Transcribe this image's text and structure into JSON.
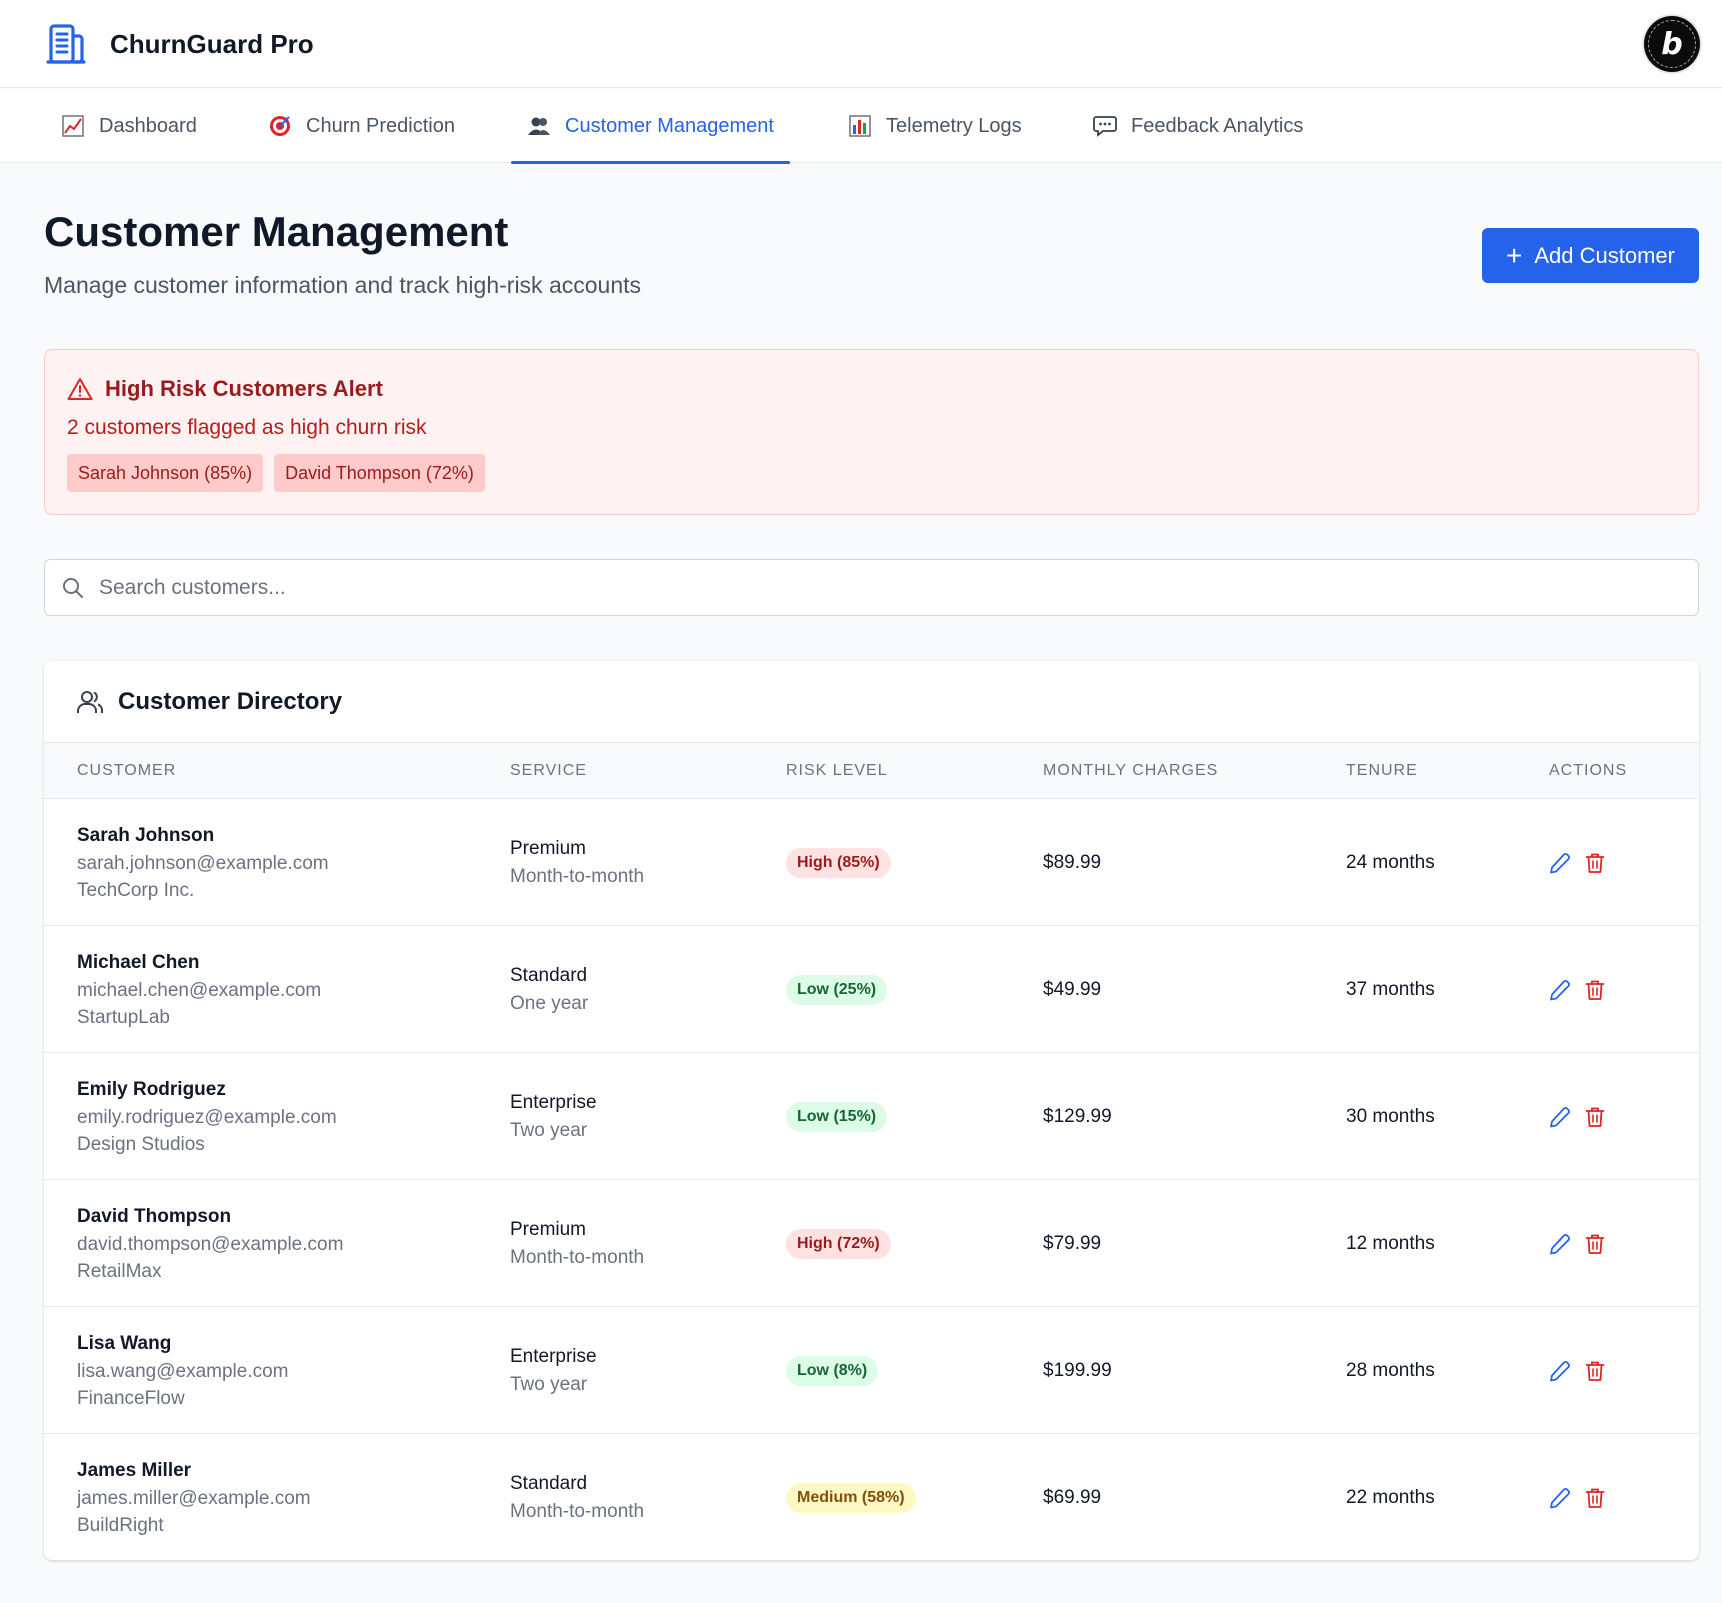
{
  "app": {
    "name": "ChurnGuard Pro",
    "logo_icon": "building-icon",
    "badge_letter": "b"
  },
  "nav": {
    "tabs": [
      {
        "label": "Dashboard",
        "icon": "chart-increasing-icon",
        "active": false
      },
      {
        "label": "Churn Prediction",
        "icon": "target-icon",
        "active": false
      },
      {
        "label": "Customer Management",
        "icon": "users-icon",
        "active": true
      },
      {
        "label": "Telemetry Logs",
        "icon": "bar-chart-icon",
        "active": false
      },
      {
        "label": "Feedback Analytics",
        "icon": "speech-bubble-icon",
        "active": false
      }
    ]
  },
  "page": {
    "title": "Customer Management",
    "subtitle": "Manage customer information and track high-risk accounts",
    "add_button": "Add Customer"
  },
  "alert": {
    "title": "High Risk Customers Alert",
    "description": "2 customers flagged as high churn risk",
    "chips": [
      "Sarah Johnson (85%)",
      "David Thompson (72%)"
    ]
  },
  "search": {
    "placeholder": "Search customers..."
  },
  "directory": {
    "title": "Customer Directory",
    "columns": [
      "CUSTOMER",
      "SERVICE",
      "RISK LEVEL",
      "MONTHLY CHARGES",
      "TENURE",
      "ACTIONS"
    ],
    "rows": [
      {
        "name": "Sarah Johnson",
        "email": "sarah.johnson@example.com",
        "company": "TechCorp Inc.",
        "plan": "Premium",
        "contract": "Month-to-month",
        "risk": "High (85%)",
        "risk_level": "high",
        "charges": "$89.99",
        "tenure": "24 months"
      },
      {
        "name": "Michael Chen",
        "email": "michael.chen@example.com",
        "company": "StartupLab",
        "plan": "Standard",
        "contract": "One year",
        "risk": "Low (25%)",
        "risk_level": "low",
        "charges": "$49.99",
        "tenure": "37 months"
      },
      {
        "name": "Emily Rodriguez",
        "email": "emily.rodriguez@example.com",
        "company": "Design Studios",
        "plan": "Enterprise",
        "contract": "Two year",
        "risk": "Low (15%)",
        "risk_level": "low",
        "charges": "$129.99",
        "tenure": "30 months"
      },
      {
        "name": "David Thompson",
        "email": "david.thompson@example.com",
        "company": "RetailMax",
        "plan": "Premium",
        "contract": "Month-to-month",
        "risk": "High (72%)",
        "risk_level": "high",
        "charges": "$79.99",
        "tenure": "12 months"
      },
      {
        "name": "Lisa Wang",
        "email": "lisa.wang@example.com",
        "company": "FinanceFlow",
        "plan": "Enterprise",
        "contract": "Two year",
        "risk": "Low (8%)",
        "risk_level": "low",
        "charges": "$199.99",
        "tenure": "28 months"
      },
      {
        "name": "James Miller",
        "email": "james.miller@example.com",
        "company": "BuildRight",
        "plan": "Standard",
        "contract": "Month-to-month",
        "risk": "Medium (58%)",
        "risk_level": "medium",
        "charges": "$69.99",
        "tenure": "22 months"
      }
    ]
  },
  "colors": {
    "accent": "#2563eb",
    "danger": "#dc2626",
    "alert_bg": "#fef2f2"
  }
}
